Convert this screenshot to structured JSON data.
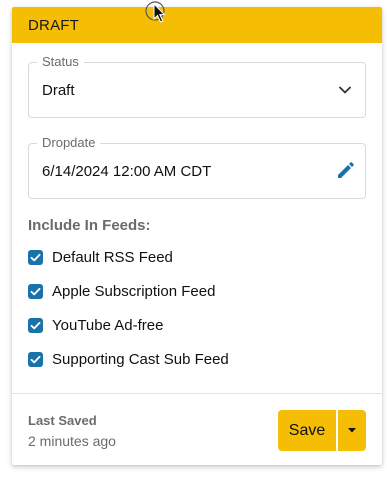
{
  "header": {
    "title": "DRAFT",
    "color": "#f6bd05"
  },
  "status_field": {
    "label": "Status",
    "value": "Draft",
    "icon": "chevron-down-icon"
  },
  "dropdate_field": {
    "label": "Dropdate",
    "value": "6/14/2024 12:00 AM CDT",
    "icon": "pencil-icon",
    "icon_color": "#1a73a8"
  },
  "feeds": {
    "heading": "Include In Feeds:",
    "items": [
      {
        "label": "Default RSS Feed",
        "checked": true
      },
      {
        "label": "Apple Subscription Feed",
        "checked": true
      },
      {
        "label": "YouTube Ad-free",
        "checked": true
      },
      {
        "label": "Supporting Cast Sub Feed",
        "checked": true
      }
    ],
    "checkbox_color": "#1a73a8"
  },
  "footer": {
    "last_saved_label": "Last Saved",
    "last_saved_time": "2 minutes ago",
    "save_label": "Save",
    "save_menu_icon": "caret-down-icon",
    "accent": "#f6bd05"
  }
}
